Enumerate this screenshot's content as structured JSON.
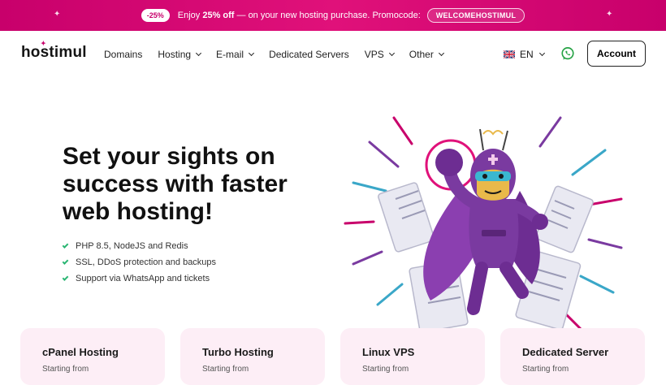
{
  "promo": {
    "badge": "-25%",
    "lead": "Enjoy ",
    "discount": "25% off",
    "rest": " — on your new hosting purchase. Promocode:",
    "code": "WELCOMEHOSTIMUL"
  },
  "header": {
    "logo": "hostimul",
    "nav": [
      {
        "label": "Domains",
        "dropdown": false
      },
      {
        "label": "Hosting",
        "dropdown": true
      },
      {
        "label": "E-mail",
        "dropdown": true
      },
      {
        "label": "Dedicated Servers",
        "dropdown": false
      },
      {
        "label": "VPS",
        "dropdown": true
      },
      {
        "label": "Other",
        "dropdown": true
      }
    ],
    "language": "EN",
    "account_label": "Account"
  },
  "hero": {
    "title": "Set your sights on success with faster web hosting!",
    "features": [
      "PHP 8.5, NodeJS and Redis",
      "SSL, DDoS protection and backups",
      "Support via WhatsApp and tickets"
    ]
  },
  "cards": [
    {
      "title": "cPanel Hosting",
      "subtitle": "Starting from"
    },
    {
      "title": "Turbo Hosting",
      "subtitle": "Starting from"
    },
    {
      "title": "Linux VPS",
      "subtitle": "Starting from"
    },
    {
      "title": "Dedicated Server",
      "subtitle": "Starting from"
    }
  ],
  "colors": {
    "brand": "#c8006b",
    "card_bg": "#fdeef6",
    "check": "#2bb673",
    "whatsapp": "#25a244",
    "mascot": "#7a3aa0"
  }
}
